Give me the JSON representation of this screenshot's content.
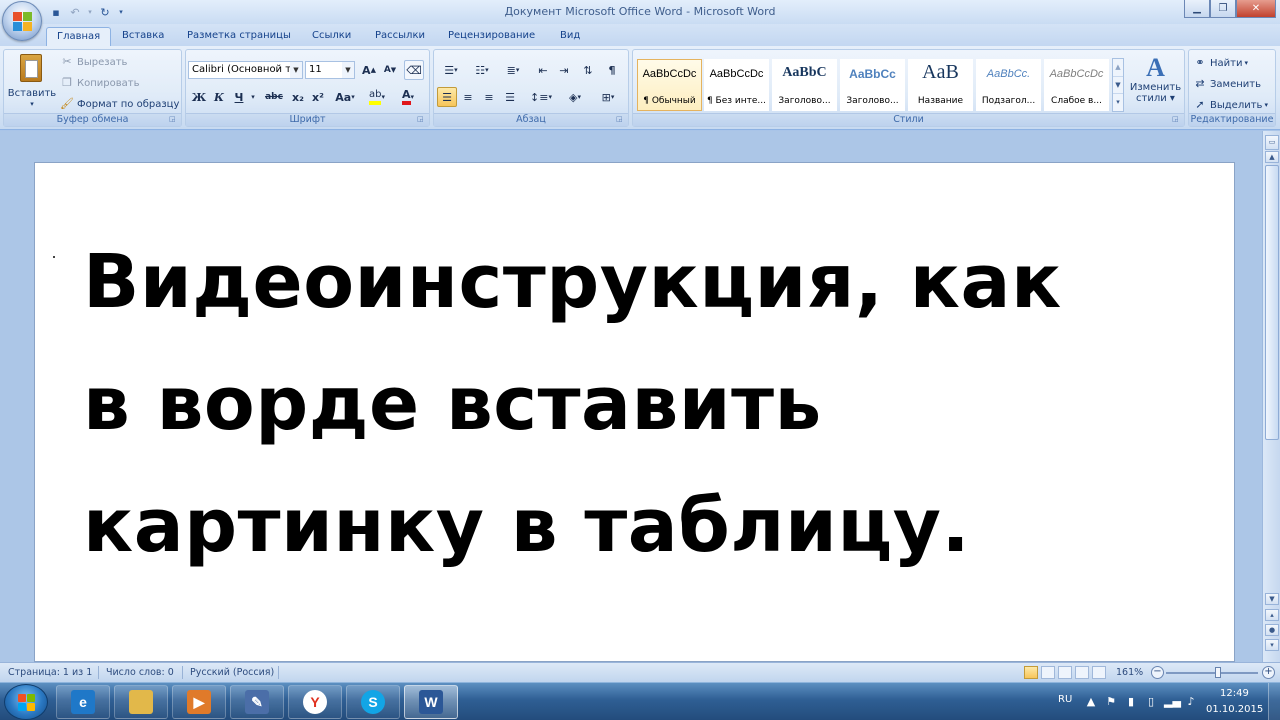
{
  "window": {
    "title": "Документ Microsoft Office Word - Microsoft Word",
    "minimize_icon": "minimize-icon",
    "maximize_icon": "restore-icon",
    "close_icon": "close-icon"
  },
  "tabs": [
    "Главная",
    "Вставка",
    "Разметка страницы",
    "Ссылки",
    "Рассылки",
    "Рецензирование",
    "Вид"
  ],
  "active_tab": "Главная",
  "ribbon": {
    "clipboard": {
      "label": "Буфер обмена",
      "paste": "Вставить",
      "cut": "Вырезать",
      "copy": "Копировать",
      "format_painter": "Формат по образцу"
    },
    "font": {
      "label": "Шрифт",
      "font_name": "Calibri (Основной текст)",
      "font_size": "11",
      "bold": "Ж",
      "italic": "К",
      "underline": "Ч",
      "strike": "abc",
      "subscript": "x₂",
      "superscript": "x²",
      "change_case": "Aa",
      "grow": "A",
      "shrink": "A"
    },
    "paragraph": {
      "label": "Абзац"
    },
    "styles": {
      "label": "Стили",
      "items": [
        {
          "preview": "AaBbCcDc",
          "name": "¶ Обычный"
        },
        {
          "preview": "AaBbCcDc",
          "name": "¶ Без инте..."
        },
        {
          "preview": "AaBbC",
          "name": "Заголово..."
        },
        {
          "preview": "AaBbCc",
          "name": "Заголово..."
        },
        {
          "preview": "AaB",
          "name": "Название"
        },
        {
          "preview": "AaBbCc.",
          "name": "Подзагол..."
        },
        {
          "preview": "AaBbCcDc",
          "name": "Слабое в..."
        }
      ],
      "change_styles_1": "Изменить",
      "change_styles_2": "стили"
    },
    "editing": {
      "label": "Редактирование",
      "find": "Найти",
      "replace": "Заменить",
      "select": "Выделить"
    }
  },
  "document": {
    "lines": [
      "Видеоинструкция, как",
      "в ворде вставить",
      "картинку в таблицу."
    ]
  },
  "statusbar": {
    "page": "Страница: 1 из 1",
    "words": "Число слов: 0",
    "language": "Русский (Россия)",
    "zoom": "161%",
    "zoom_minus": "−",
    "zoom_plus": "+"
  },
  "taskbar": {
    "items": [
      {
        "name": "internet-explorer",
        "glyph": "e",
        "color": "#1f78c8"
      },
      {
        "name": "file-explorer",
        "glyph": "",
        "color": "#e2b84a"
      },
      {
        "name": "media-player",
        "glyph": "▶",
        "color": "#e07a2a"
      },
      {
        "name": "paint",
        "glyph": "✎",
        "color": "#4b6ea8"
      },
      {
        "name": "yandex-browser",
        "glyph": "Y",
        "color": "#e0301e"
      },
      {
        "name": "skype",
        "glyph": "S",
        "color": "#12a5e6"
      },
      {
        "name": "word",
        "glyph": "W",
        "color": "#2b5797"
      }
    ],
    "lang": "RU",
    "time": "12:49",
    "date": "01.10.2015"
  }
}
